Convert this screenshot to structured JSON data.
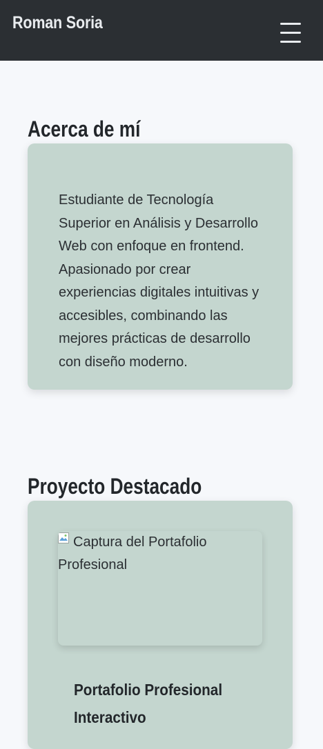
{
  "header": {
    "brand": "Roman Soria",
    "menu_icon": "hamburger-menu-icon"
  },
  "about": {
    "title": "Acerca de mí",
    "body": "Estudiante de Tecnología Superior en Análisis y Desarrollo Web con enfoque en frontend. Apasionado por crear experiencias digitales intuitivas y accesibles, combinando las mejores prácticas de desarrollo con diseño moderno."
  },
  "project": {
    "section_title": "Proyecto Destacado",
    "image_alt": "Captura del Portafolio Profesional",
    "image_icon": "broken-image-icon",
    "name": "Portafolio Profesional Interactivo"
  },
  "colors": {
    "header_bg": "#2b2f33",
    "page_bg": "#f6f8fb",
    "card_bg": "#c4d6cf",
    "text": "#2b2f33"
  }
}
